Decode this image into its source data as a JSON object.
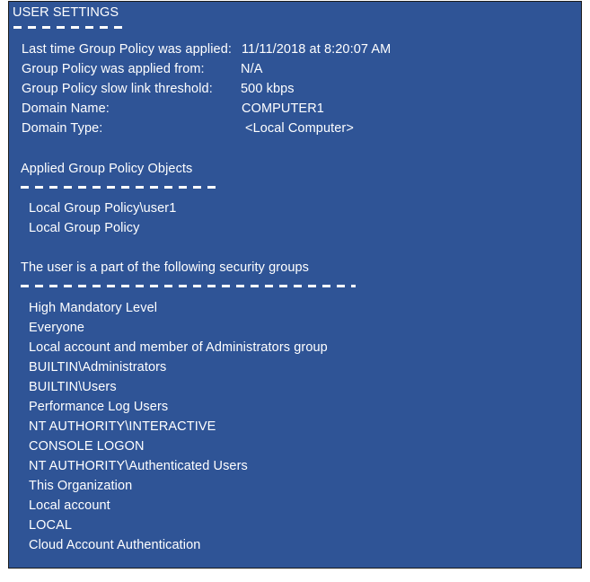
{
  "panel": {
    "background_color": "#2F5496",
    "text_color": "#FFFFFF",
    "border_color": "#1B1B1B"
  },
  "header": {
    "title": "USER SETTINGS"
  },
  "summary": {
    "rows": [
      {
        "label": "Last time Group Policy was applied:",
        "value": "11/11/2018 at 8:20:07 AM"
      },
      {
        "label": "Group Policy was applied from:",
        "value": "N/A"
      },
      {
        "label": "Group Policy slow link threshold:",
        "value": "500 kbps"
      },
      {
        "label": "Domain Name:",
        "value": "COMPUTER1"
      },
      {
        "label": "Domain Type:",
        "value": "<Local Computer>"
      }
    ]
  },
  "applied_gpos": {
    "heading": "Applied Group Policy Objects",
    "items": [
      "Local Group Policy\\user1",
      "Local Group Policy"
    ]
  },
  "security_groups": {
    "heading": "The user is a part of the following security groups",
    "items": [
      "High Mandatory Level",
      "Everyone",
      "Local account and member of Administrators group",
      "BUILTIN\\Administrators",
      "BUILTIN\\Users",
      "Performance Log Users",
      "NT AUTHORITY\\INTERACTIVE",
      "CONSOLE LOGON",
      "NT AUTHORITY\\Authenticated Users",
      "This Organization",
      "Local account",
      "LOCAL",
      "Cloud Account Authentication"
    ]
  }
}
